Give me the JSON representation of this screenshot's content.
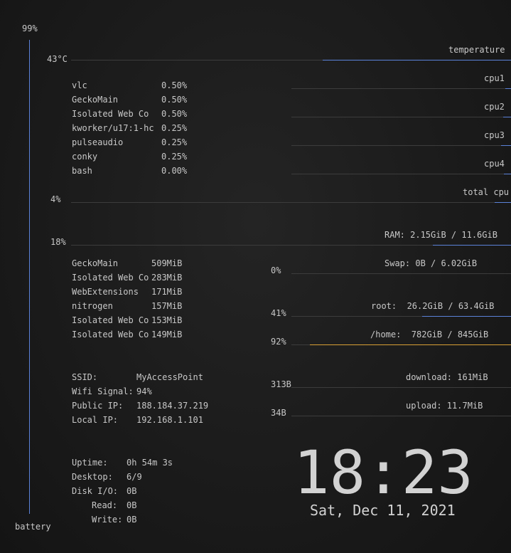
{
  "battery": {
    "percent_label": "99%",
    "label": "battery",
    "level": 0.99
  },
  "temperature": {
    "value_label": "43°C",
    "label": "temperature",
    "level": 0.43
  },
  "cpus": [
    {
      "label": "cpu1",
      "level": 0.01
    },
    {
      "label": "cpu2",
      "level": 0.02
    },
    {
      "label": "cpu3",
      "level": 0.02
    },
    {
      "label": "cpu4",
      "level": 0.02
    }
  ],
  "total_cpu": {
    "percent_label": "4%",
    "label": "total cpu",
    "level": 0.04
  },
  "top_cpu": [
    {
      "name": "vlc",
      "value": "0.50%"
    },
    {
      "name": "GeckoMain",
      "value": "0.50%"
    },
    {
      "name": "Isolated Web Co",
      "value": "0.50%"
    },
    {
      "name": "kworker/u17:1-hc",
      "value": "0.25%"
    },
    {
      "name": "pulseaudio",
      "value": "0.25%"
    },
    {
      "name": "conky",
      "value": "0.25%"
    },
    {
      "name": "bash",
      "value": "0.00%"
    }
  ],
  "memory": {
    "percent_label": "18%",
    "ram_label": "RAM: 2.15GiB / 11.6GiB",
    "ram_level": 0.18,
    "swap_percent_label": "0%",
    "swap_label": "Swap: 0B / 6.02GiB",
    "swap_level": 0.0
  },
  "top_mem": [
    {
      "name": "GeckoMain",
      "value": "509MiB"
    },
    {
      "name": "Isolated Web Co",
      "value": "283MiB"
    },
    {
      "name": "WebExtensions",
      "value": "171MiB"
    },
    {
      "name": "nitrogen",
      "value": "157MiB"
    },
    {
      "name": "Isolated Web Co",
      "value": "153MiB"
    },
    {
      "name": "Isolated Web Co",
      "value": "149MiB"
    }
  ],
  "disks": [
    {
      "percent_label": "41%",
      "label": "root:  26.2GiB / 63.4GiB",
      "level": 0.41,
      "color": "#5b82d9"
    },
    {
      "percent_label": "92%",
      "label": "/home:  782GiB / 845GiB",
      "level": 0.92,
      "color": "#d9a035"
    }
  ],
  "network": [
    {
      "key": "SSID:",
      "value": "MyAccessPoint"
    },
    {
      "key": "Wifi Signal:",
      "value": "94%"
    },
    {
      "key": "Public IP:",
      "value": "188.184.37.219"
    },
    {
      "key": "Local IP:",
      "value": "192.168.1.101"
    }
  ],
  "traffic": {
    "down_rate": "313B",
    "down_label": "download: 161MiB",
    "up_rate": "34B",
    "up_label": "upload: 11.7MiB"
  },
  "system": {
    "uptime_key": "Uptime:",
    "uptime": "0h 54m 3s",
    "desktop_key": "Desktop:",
    "desktop": "6/9",
    "diskio_key": "Disk I/O:",
    "diskio": "0B",
    "read_key": "Read:",
    "read": "0B",
    "write_key": "Write:",
    "write": "0B"
  },
  "clock": {
    "time": "18:23",
    "date": "Sat, Dec 11, 2021"
  },
  "colors": {
    "accent": "#5b82d9",
    "warning": "#d9a035",
    "text": "#c8c8c8",
    "background": "#1b1b1b"
  }
}
